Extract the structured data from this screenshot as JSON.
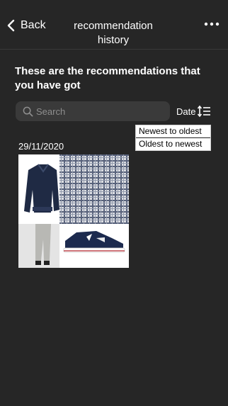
{
  "header": {
    "back_label": "Back",
    "title": "recommendation history"
  },
  "heading": "These are the recommendations that you have got",
  "search": {
    "placeholder": "Search"
  },
  "sort": {
    "label": "Date",
    "options": [
      "Newest to oldest",
      "Oldest to newest"
    ]
  },
  "entries": [
    {
      "date": "29/11/2020"
    }
  ]
}
